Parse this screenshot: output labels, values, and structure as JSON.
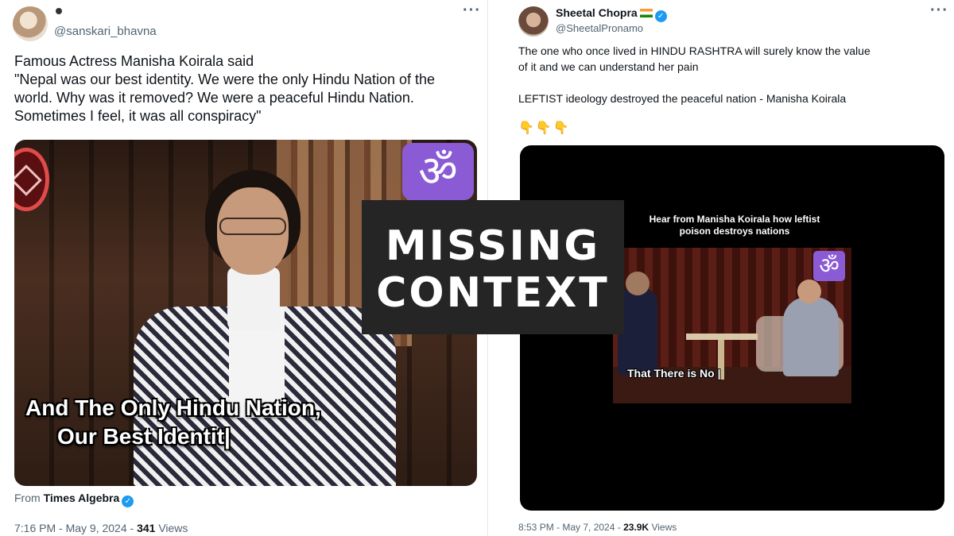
{
  "left_tweet": {
    "handle": "@sanskari_bhavna",
    "more": "···",
    "text_lines": [
      "Famous Actress Manisha Koirala said",
      "\"Nepal was our best identity. We were the only Hindu Nation of the",
      "world. Why was it removed? We were a peaceful Hindu Nation.",
      "Sometimes I feel, it was all conspiracy\""
    ],
    "media": {
      "om_symbol": "ॐ",
      "subtitle_line1": "And The Only Hindu Nation,",
      "subtitle_line2": "Our Best Identit|"
    },
    "from_prefix": "From",
    "from_source": "Times Algebra",
    "verified_glyph": "✓",
    "time": "7:16 PM - May 9, 2024 -",
    "views_count": "341",
    "views_label": "Views"
  },
  "right_tweet": {
    "display_name": "Sheetal Chopra",
    "handle": "@SheetalPronamo",
    "more": "···",
    "verified_glyph": "✓",
    "text_lines": [
      "The one who once lived  in HINDU RASHTRA will surely know the value",
      "of it and we can understand her pain",
      "",
      "LEFTIST ideology destroyed the peaceful nation - Manisha Koirala"
    ],
    "emoji": "👇👇👇",
    "media": {
      "headline": "Hear from Manisha Koirala how leftist poison destroys nations",
      "om_symbol": "ॐ",
      "subtitle": "That There is No |"
    },
    "time": "8:53 PM - May 7, 2024 -",
    "views_count": "23.9K",
    "views_label": "Views"
  },
  "overlay": {
    "line1": "MISSING",
    "line2": "CONTEXT"
  }
}
